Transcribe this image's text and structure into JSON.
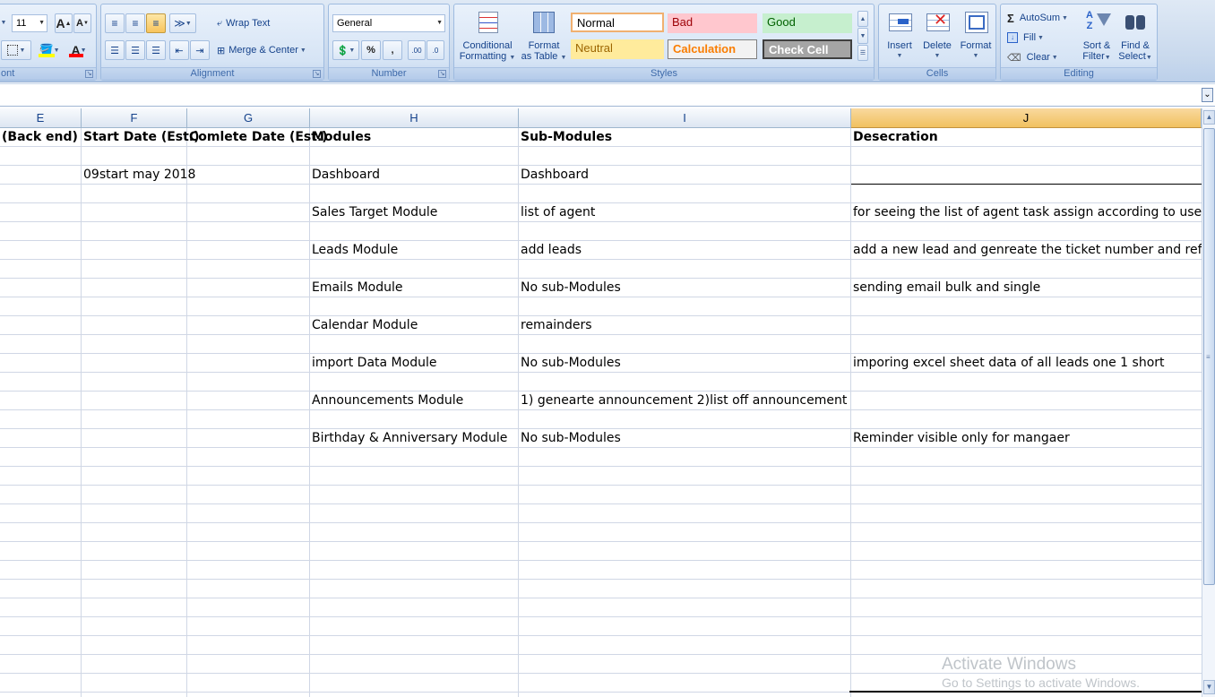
{
  "ribbon": {
    "font": {
      "size_value": "11",
      "group_label": "ont"
    },
    "alignment": {
      "wrap_text_label": "Wrap Text",
      "merge_center_label": "Merge & Center",
      "group_label": "Alignment"
    },
    "number": {
      "format_value": "General",
      "percent_symbol": "%",
      "comma_symbol": ",",
      "group_label": "Number"
    },
    "styles": {
      "conditional_formatting_label_1": "Conditional",
      "conditional_formatting_label_2": "Formatting",
      "format_as_table_label_1": "Format",
      "format_as_table_label_2": "as Table",
      "normal": "Normal",
      "bad": "Bad",
      "good": "Good",
      "neutral": "Neutral",
      "calculation": "Calculation",
      "check_cell": "Check Cell",
      "group_label": "Styles"
    },
    "cells": {
      "insert_label": "Insert",
      "delete_label": "Delete",
      "format_label": "Format",
      "group_label": "Cells"
    },
    "editing": {
      "autosum_label": "AutoSum",
      "fill_label": "Fill",
      "clear_label": "Clear",
      "sort_filter_label_1": "Sort &",
      "sort_filter_label_2": "Filter",
      "find_select_label_1": "Find &",
      "find_select_label_2": "Select",
      "group_label": "Editing"
    }
  },
  "grid": {
    "columns": [
      "E",
      "F",
      "G",
      "H",
      "I",
      "J"
    ],
    "selected_column": "J",
    "header_row": {
      "E": "(Back end)",
      "F": "Start Date (Est.)",
      "G": "Comlete Date (Est.)",
      "H": "Modules",
      "I": "Sub-Modules",
      "J": "Desecration"
    },
    "rows": [
      {
        "F": "",
        "H": "",
        "I": "",
        "J": ""
      },
      {
        "F": "09start may 2018",
        "H": "Dashboard",
        "I": "Dashboard",
        "J": ""
      },
      {
        "F": "",
        "H": "",
        "I": "",
        "J": ""
      },
      {
        "F": "",
        "H": "Sales Target Module",
        "I": "list of agent",
        "J": "for seeing the list of agent task assign according to user"
      },
      {
        "F": "",
        "H": "",
        "I": "",
        "J": ""
      },
      {
        "F": "",
        "H": "Leads Module",
        "I": "add leads",
        "J": "add a new lead and genreate the ticket number and reference"
      },
      {
        "F": "",
        "H": "",
        "I": "",
        "J": ""
      },
      {
        "F": "",
        "H": "Emails Module",
        "I": "No sub-Modules",
        "J": "sending email bulk and single"
      },
      {
        "F": "",
        "H": "",
        "I": "",
        "J": ""
      },
      {
        "F": "",
        "H": "Calendar Module",
        "I": "remainders",
        "J": ""
      },
      {
        "F": "",
        "H": "",
        "I": "",
        "J": ""
      },
      {
        "F": "",
        "H": "import Data Module",
        "I": "No sub-Modules",
        "J": "imporing excel sheet data of all leads one  1 short"
      },
      {
        "F": "",
        "H": "",
        "I": "",
        "J": ""
      },
      {
        "F": "",
        "H": "Announcements Module",
        "I": "1) genearte announcement  2)list off announcement",
        "J": ""
      },
      {
        "F": "",
        "H": "",
        "I": "",
        "J": ""
      },
      {
        "F": "",
        "H": "Birthday & Anniversary Module",
        "I": "No sub-Modules",
        "J": "Reminder visible only for mangaer"
      }
    ]
  },
  "watermark": {
    "title": "Activate Windows",
    "subtitle": "Go to Settings to activate Windows."
  },
  "colors": {
    "selected_header": "#f1c15f",
    "gridline": "#d0d7e5",
    "ribbon_text": "#15428b"
  }
}
